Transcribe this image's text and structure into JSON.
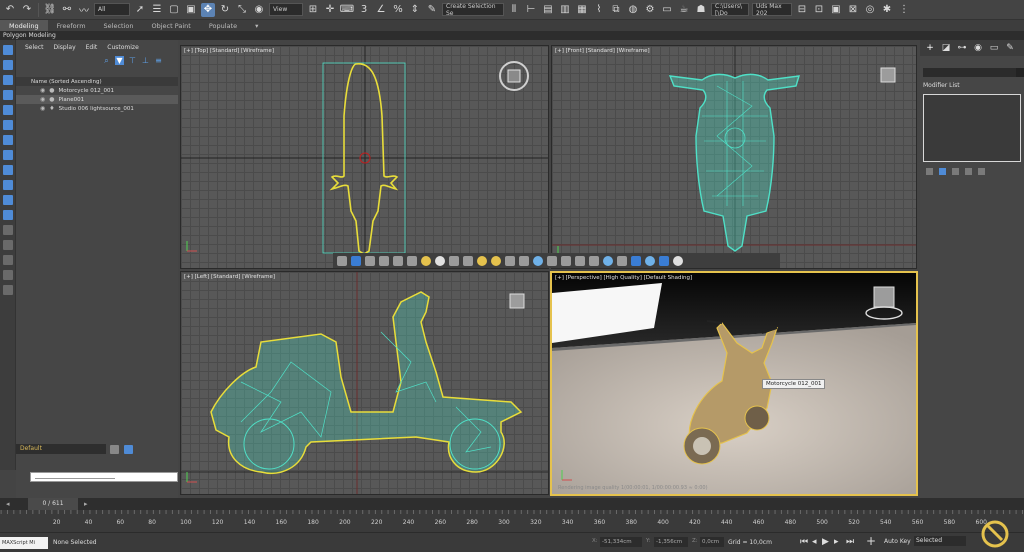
{
  "toolbar": {
    "filter_value": "All",
    "refcoord_value": "View",
    "selection_set_placeholder": "Create Selection Se",
    "project_path": "C:\\Users\\[\\Do",
    "workspace": "Uds Max 202"
  },
  "ribbon": {
    "tabs": [
      "Modeling",
      "Freeform",
      "Selection",
      "Object Paint",
      "Populate"
    ],
    "active_tab": "Modeling",
    "subtitle": "Polygon Modeling"
  },
  "explorer": {
    "menu": [
      "Select",
      "Display",
      "Edit",
      "Customize"
    ],
    "column_header": "Name (Sorted Ascending)",
    "rows": [
      {
        "name": "Motorcycle 012_001",
        "selected": false
      },
      {
        "name": "Plane001",
        "selected": true
      },
      {
        "name": "Studio 006 lightsource_001",
        "selected": false
      }
    ],
    "layer": "Default"
  },
  "viewports": {
    "top": "[+] [Top] [Standard] [Wireframe]",
    "front": "[+] [Front] [Standard] [Wireframe]",
    "left": "[+] [Left] [Standard] [Wireframe]",
    "perspective": "[+] [Perspective] [High Quality] [Default Shading]",
    "object_tooltip": "Motorcycle 012_001",
    "render_status": "Rendering image quality 1(00:00:01, 1/00:00:00.93 ≈ 0:00)"
  },
  "command_panel": {
    "modifier_list_label": "Modifier List"
  },
  "timeline": {
    "frame_readout": "0 / 611",
    "ticks": [
      20,
      40,
      60,
      80,
      100,
      120,
      140,
      160,
      180,
      200,
      220,
      240,
      260,
      280,
      300,
      320,
      340,
      360,
      380,
      400,
      420,
      440,
      460,
      480,
      500,
      520,
      540,
      560,
      580,
      600
    ]
  },
  "status": {
    "mini_listener": "MAXScript Mi",
    "selection": "None Selected",
    "x_label": "X:",
    "x_value": "-51,334cm",
    "y_label": "Y:",
    "y_value": "-1,356cm",
    "z_label": "Z:",
    "z_value": "0,0cm",
    "grid": "Grid = 10,0cm",
    "auto_key": "Auto Key",
    "set_key_mode": "Selected"
  },
  "colors": {
    "accent": "#5c83b4",
    "wireframe": "#4fe0c7",
    "selection_outline": "#e5c24d",
    "grid": "#585858"
  }
}
